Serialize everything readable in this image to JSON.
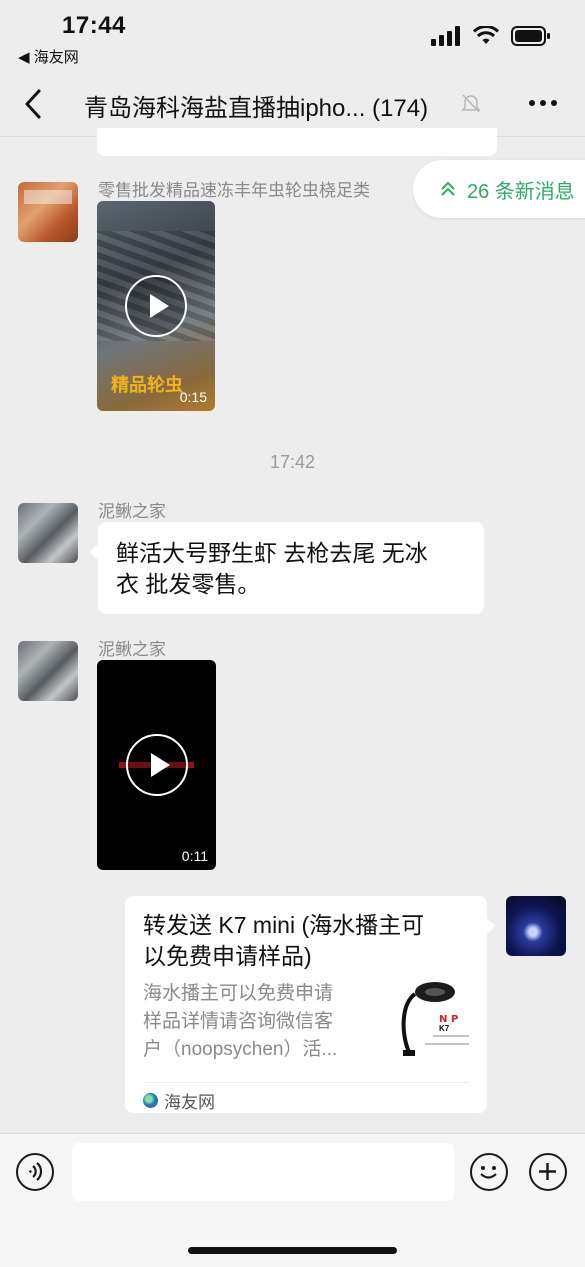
{
  "status_bar": {
    "time": "17:44",
    "back_app": "◀ 海友网"
  },
  "nav": {
    "title": "青岛海科海盐直播抽ipho... (174)"
  },
  "new_messages": {
    "label": "26 条新消息"
  },
  "messages": [
    {
      "type": "video",
      "sender": "零售批发精品速冻丰年虫轮虫桡足类",
      "caption": "精品轮虫",
      "duration": "0:15"
    },
    {
      "type": "time",
      "text": "17:42"
    },
    {
      "type": "text",
      "sender": "泥鳅之家",
      "line1": "鲜活大号野生虾 去枪去尾 无冰",
      "line2": "衣  批发零售。"
    },
    {
      "type": "video",
      "sender": "泥鳅之家",
      "duration": "0:11"
    },
    {
      "type": "link",
      "title_line1": "转发送 K7 mini (海水播主可",
      "title_line2": "以免费申请样品)",
      "desc_line1": "海水播主可以免费申请",
      "desc_line2": "样品详情请咨询微信客",
      "desc_line3": "户（noopsychen）活...",
      "source": "海友网",
      "thumb_brand": "K7"
    }
  ],
  "icons": {
    "back": "chevron-left-icon",
    "mute": "bell-slash-icon",
    "more": "more-icon",
    "voice": "voice-icon",
    "emoji": "emoji-icon",
    "plus": "plus-icon"
  },
  "colors": {
    "accent_green": "#2aae67",
    "background": "#ededed"
  }
}
